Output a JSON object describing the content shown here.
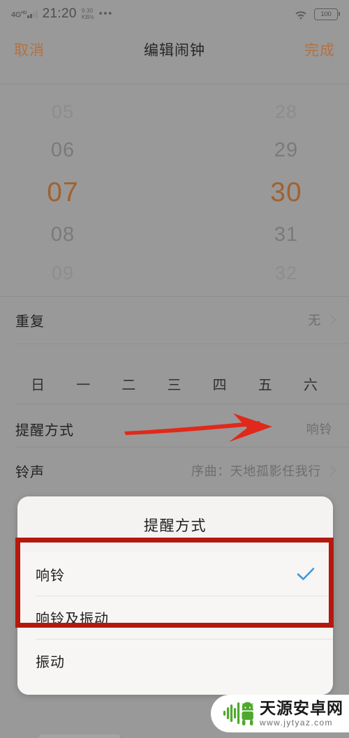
{
  "status_bar": {
    "network_type": "4G",
    "network_sup": "HD",
    "time": "21:20",
    "speed_value": "9.30",
    "speed_unit": "KB/s",
    "overflow": "•••",
    "wifi_icon": "wifi-icon",
    "battery_level": "100"
  },
  "header": {
    "cancel_label": "取消",
    "title": "编辑闹钟",
    "done_label": "完成"
  },
  "time_picker": {
    "hours": [
      "05",
      "06",
      "07",
      "08",
      "09"
    ],
    "minutes": [
      "28",
      "29",
      "30",
      "31",
      "32"
    ],
    "selected_hour": "07",
    "selected_minute": "30",
    "selected_color": "#a0622f"
  },
  "rows": {
    "repeat": {
      "label": "重复",
      "value": "无"
    },
    "weekdays": [
      "日",
      "一",
      "二",
      "三",
      "四",
      "五",
      "六"
    ],
    "reminder": {
      "label": "提醒方式",
      "value": "响铃"
    },
    "ringtone": {
      "label": "铃声",
      "value": "序曲：天地孤影任我行"
    }
  },
  "annotations": {
    "arrow_color": "#e0291a",
    "box_color": "#b5180c"
  },
  "dialog": {
    "title": "提醒方式",
    "options": [
      {
        "label": "响铃",
        "checked": true
      },
      {
        "label": "响铃及振动",
        "checked": false
      },
      {
        "label": "振动",
        "checked": false
      }
    ],
    "check_color": "#3d9ae0"
  },
  "watermark": {
    "name": "天源安卓网",
    "url": "www.jytyaz.com",
    "logo_color": "#4fa82e"
  }
}
